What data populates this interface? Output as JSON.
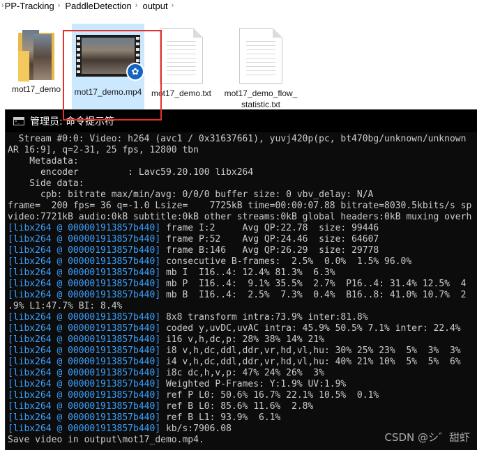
{
  "breadcrumb": [
    "PP-Tracking",
    "PaddleDetection",
    "output"
  ],
  "files": [
    {
      "name": "mot17_demo",
      "type": "folder",
      "icon": "folder-icon"
    },
    {
      "name": "mot17_demo.mp4",
      "type": "video",
      "icon": "video-file-icon",
      "selected": true
    },
    {
      "name": "mot17_demo.txt",
      "type": "text",
      "icon": "text-file-icon"
    },
    {
      "name": "mot17_demo_flow_statistic.txt",
      "type": "text",
      "icon": "text-file-icon"
    }
  ],
  "highlight_color": "#e8302a",
  "console": {
    "title": "管理员: 命令提示符",
    "lines": [
      "  Stream #0:0: Video: h264 (avc1 / 0x31637661), yuvj420p(pc, bt470bg/unknown/unknown",
      "AR 16:9], q=2-31, 25 fps, 12800 tbn",
      "    Metadata:",
      "      encoder         : Lavc59.20.100 libx264",
      "    Side data:",
      "      cpb: bitrate max/min/avg: 0/0/0 buffer size: 0 vbv_delay: N/A",
      "frame=  200 fps= 36 q=-1.0 Lsize=    7725kB time=00:00:07.88 bitrate=8030.5kbits/s sp",
      "video:7721kB audio:0kB subtitle:0kB other streams:0kB global headers:0kB muxing overh"
    ],
    "libx264_tag": "[libx264 @ 000001913857b440]",
    "libx264_lines": [
      " frame I:2     Avg QP:22.78  size: 99446",
      " frame P:52    Avg QP:24.46  size: 64607",
      " frame B:146   Avg QP:26.29  size: 29778",
      " consecutive B-frames:  2.5%  0.0%  1.5% 96.0%",
      " mb I  I16..4: 12.4% 81.3%  6.3%",
      " mb P  I16..4:  9.1% 35.5%  2.7%  P16..4: 31.4% 12.5%  4",
      " mb B  I16..4:  2.5%  7.3%  0.4%  B16..8: 41.0% 10.7%  2"
    ],
    "wrap_line": ".9% L1:47.7% BI: 8.4%",
    "libx264_lines_2": [
      " 8x8 transform intra:73.9% inter:81.8%",
      " coded y,uvDC,uvAC intra: 45.9% 50.5% 7.1% inter: 22.4%",
      " i16 v,h,dc,p: 28% 38% 14% 21%",
      " i8 v,h,dc,ddl,ddr,vr,hd,vl,hu: 30% 25% 23%  5%  3%  3%",
      " i4 v,h,dc,ddl,ddr,vr,hd,vl,hu: 40% 21% 10%  5%  5%  6%",
      " i8c dc,h,v,p: 47% 24% 26%  3%",
      " Weighted P-Frames: Y:1.9% UV:1.9%",
      " ref P L0: 50.6% 16.7% 22.1% 10.5%  0.1%",
      " ref B L0: 85.6% 11.6%  2.8%",
      " ref B L1: 93.9%  6.1%",
      " kb/s:7906.08"
    ],
    "final_line": "Save video in output\\mot17_demo.mp4.",
    "tag_color": "#3aa0ff"
  },
  "watermark": "CSDN @シ゛甜虾"
}
